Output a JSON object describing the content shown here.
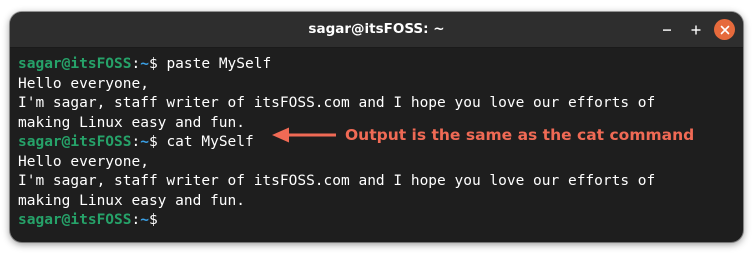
{
  "window": {
    "title": "sagar@itsFOSS: ~",
    "controls": [
      "minimize-icon",
      "maximize-icon",
      "close-icon"
    ],
    "colors": {
      "titlebar": "#2e2e2e",
      "background": "#1e1e1e",
      "prompt_user": "#26a269",
      "prompt_path": "#3aa0e6",
      "close_button": "#e66a3c",
      "annotation": "#f06a55"
    }
  },
  "terminal": {
    "prompt_user": "sagar@itsFOSS",
    "prompt_sep": ":",
    "prompt_path": "~",
    "prompt_symbol": "$ ",
    "command1": "paste MySelf",
    "output1": [
      "Hello everyone,",
      "I'm sagar, staff writer of itsFOSS.com and I hope you love our efforts of",
      "making Linux easy and fun."
    ],
    "command2": "cat MySelf",
    "output2": [
      "Hello everyone,",
      "I'm sagar, staff writer of itsFOSS.com and I hope you love our efforts of",
      "making Linux easy and fun."
    ]
  },
  "annotation": {
    "text": "Output is the same as the cat command",
    "icon": "arrow-left-icon"
  }
}
